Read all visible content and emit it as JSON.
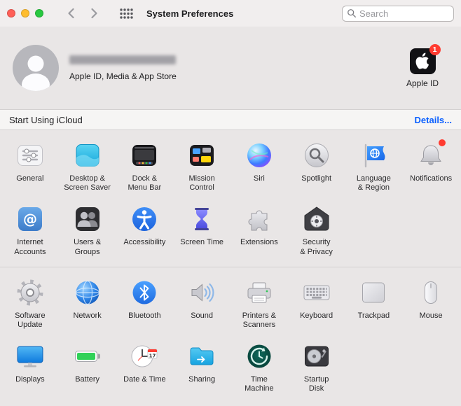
{
  "titlebar": {
    "title": "System Preferences",
    "search_placeholder": "Search"
  },
  "apple_id": {
    "subtitle": "Apple ID, Media & App Store",
    "sidebar_label": "Apple ID",
    "badge_count": "1"
  },
  "banner": {
    "text": "Start Using iCloud",
    "link_label": "Details..."
  },
  "colors": {
    "accent_blue": "#0a60ff",
    "badge_red": "#ff3b30",
    "traffic_red": "#ff5f57",
    "traffic_yellow": "#febc2e",
    "traffic_green": "#28c840"
  },
  "grid": {
    "group1": [
      {
        "label": "General",
        "icon": "general-icon"
      },
      {
        "label": "Desktop &\nScreen Saver",
        "icon": "desktop-screensaver-icon"
      },
      {
        "label": "Dock &\nMenu Bar",
        "icon": "dock-menubar-icon"
      },
      {
        "label": "Mission\nControl",
        "icon": "mission-control-icon"
      },
      {
        "label": "Siri",
        "icon": "siri-icon"
      },
      {
        "label": "Spotlight",
        "icon": "spotlight-icon"
      },
      {
        "label": "Language\n& Region",
        "icon": "language-region-icon"
      },
      {
        "label": "Notifications",
        "icon": "notifications-icon",
        "badge": true
      },
      {
        "label": "Internet\nAccounts",
        "icon": "internet-accounts-icon"
      },
      {
        "label": "Users &\nGroups",
        "icon": "users-groups-icon"
      },
      {
        "label": "Accessibility",
        "icon": "accessibility-icon"
      },
      {
        "label": "Screen Time",
        "icon": "screen-time-icon"
      },
      {
        "label": "Extensions",
        "icon": "extensions-icon"
      },
      {
        "label": "Security\n& Privacy",
        "icon": "security-privacy-icon"
      }
    ],
    "group2": [
      {
        "label": "Software\nUpdate",
        "icon": "software-update-icon"
      },
      {
        "label": "Network",
        "icon": "network-icon"
      },
      {
        "label": "Bluetooth",
        "icon": "bluetooth-icon"
      },
      {
        "label": "Sound",
        "icon": "sound-icon"
      },
      {
        "label": "Printers &\nScanners",
        "icon": "printers-scanners-icon"
      },
      {
        "label": "Keyboard",
        "icon": "keyboard-icon"
      },
      {
        "label": "Trackpad",
        "icon": "trackpad-icon"
      },
      {
        "label": "Mouse",
        "icon": "mouse-icon"
      },
      {
        "label": "Displays",
        "icon": "displays-icon"
      },
      {
        "label": "Battery",
        "icon": "battery-icon"
      },
      {
        "label": "Date & Time",
        "icon": "date-time-icon"
      },
      {
        "label": "Sharing",
        "icon": "sharing-icon"
      },
      {
        "label": "Time\nMachine",
        "icon": "time-machine-icon"
      },
      {
        "label": "Startup\nDisk",
        "icon": "startup-disk-icon"
      }
    ]
  }
}
